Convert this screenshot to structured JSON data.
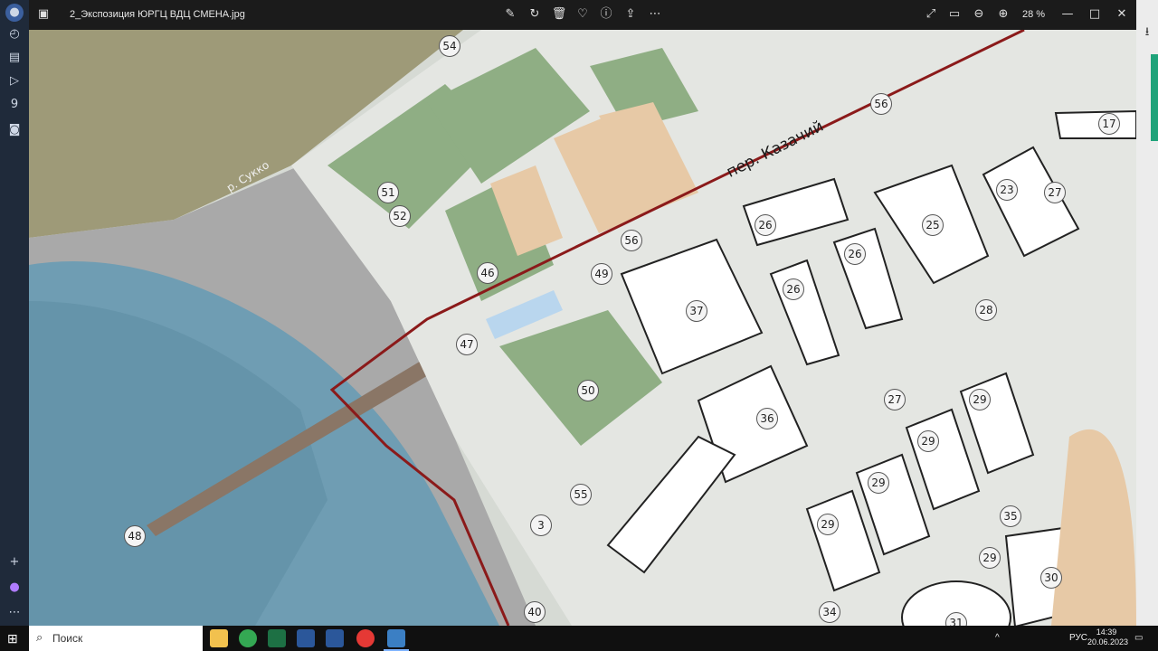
{
  "window": {
    "title": "2_Экспозиция ЮРГЦ ВДЦ СМЕНА.jpg",
    "zoom": "28 %"
  },
  "left_rail": {
    "icons": [
      "app-icon",
      "history-icon",
      "pages-icon",
      "play-icon",
      "app9-icon",
      "camera-icon",
      "add-icon",
      "alice-icon",
      "more-icon"
    ]
  },
  "toolbar": {
    "icons": [
      "edit-icon",
      "rotate-icon",
      "delete-icon",
      "favorite-icon",
      "info-icon",
      "share-icon",
      "more-icon",
      "expand-icon",
      "fit-icon",
      "zoom-out-icon",
      "zoom-in-icon"
    ],
    "window_controls": [
      "minimize-icon",
      "maximize-icon",
      "close-icon"
    ]
  },
  "map": {
    "street_label": "пер. Казачий",
    "river_label": "р. Сукко",
    "markers": [
      "54",
      "56",
      "51",
      "52",
      "56",
      "49",
      "46",
      "47",
      "50",
      "48",
      "55",
      "3",
      "40",
      "37",
      "36",
      "26",
      "26",
      "26",
      "25",
      "23",
      "27",
      "17",
      "28",
      "27",
      "29",
      "29",
      "29",
      "29",
      "29",
      "35",
      "30",
      "31",
      "34"
    ]
  },
  "taskbar": {
    "search_placeholder": "Поиск",
    "language": "РУС",
    "time": "14:39",
    "date": "20.06.2023"
  },
  "colors": {
    "sea": "#6f9db3",
    "beach": "#a7a7a7",
    "boundary": "#8b1a1a",
    "lawn": "#8fae84",
    "court": "#e7c9a6"
  }
}
